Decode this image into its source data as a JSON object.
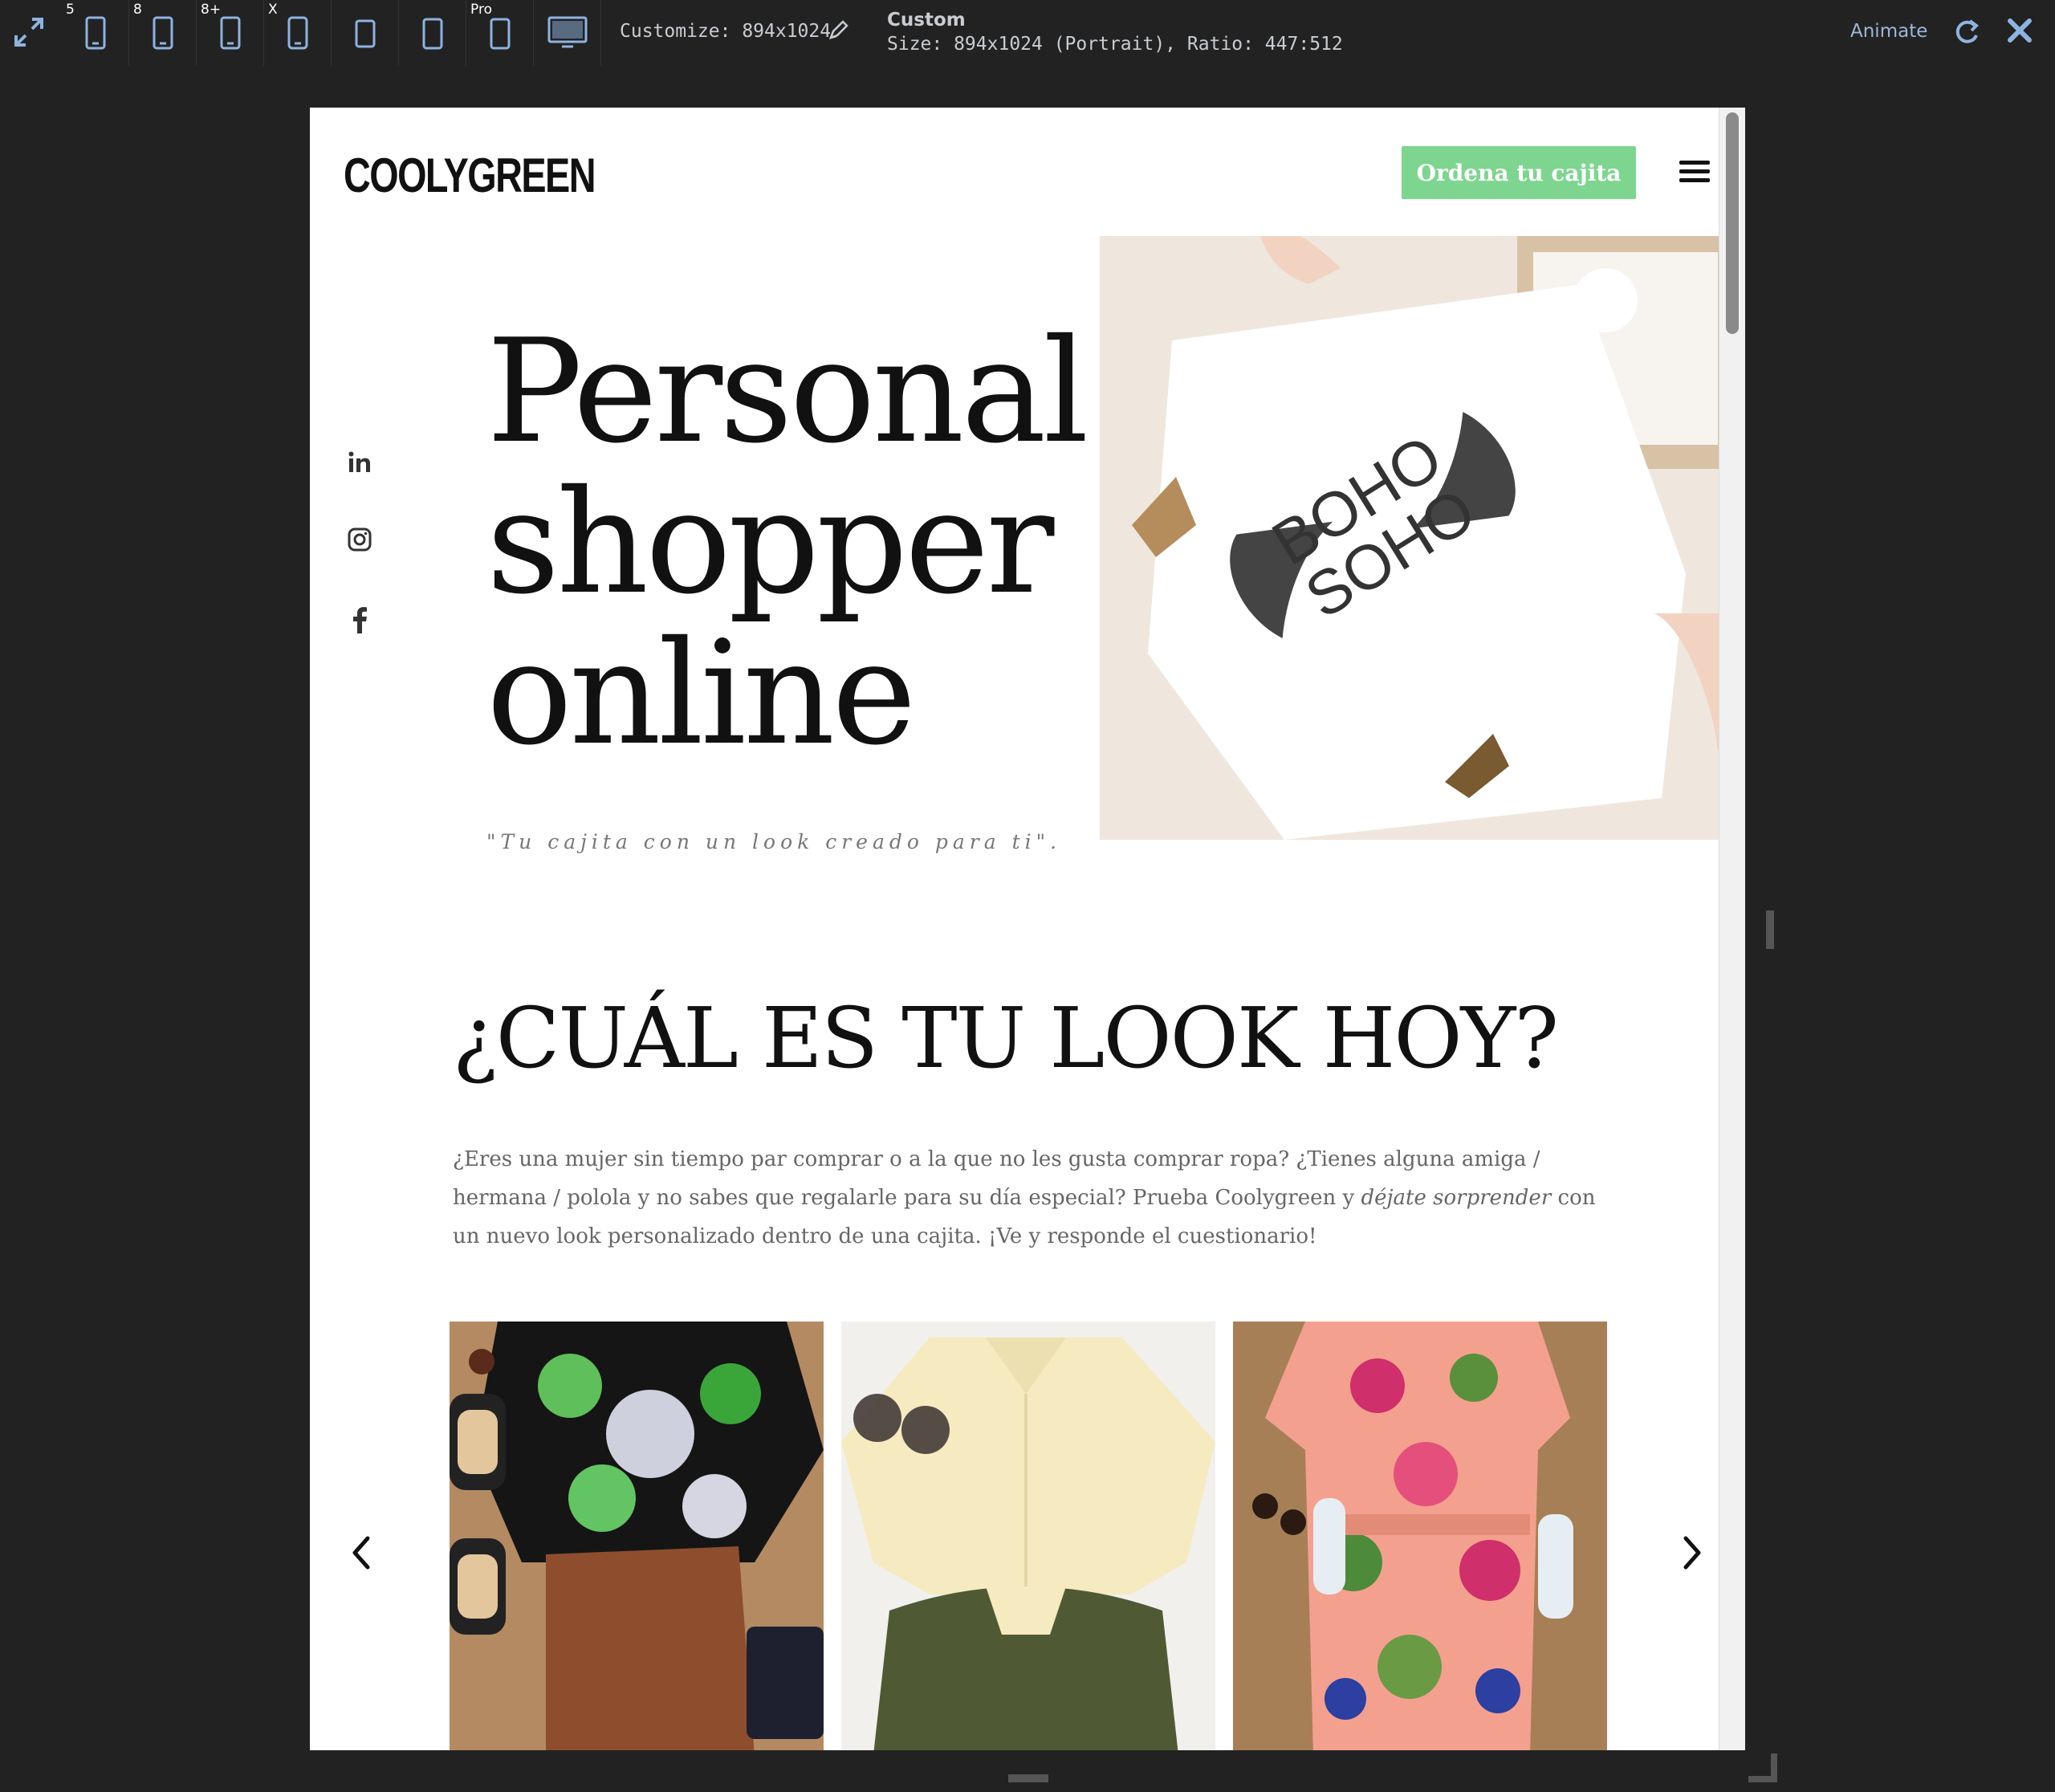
{
  "toolbar": {
    "devices": [
      {
        "label": "5"
      },
      {
        "label": "8"
      },
      {
        "label": "8+"
      },
      {
        "label": "X"
      },
      {
        "label": ""
      },
      {
        "label": ""
      },
      {
        "label": "Pro"
      }
    ],
    "customize_label": "Customize: 894x1024",
    "title": "Custom",
    "size_label": "Size: 894x1024 (Portrait), Ratio: 447:512",
    "animate_label": "Animate"
  },
  "page": {
    "logo": "COOLYGREEN",
    "cta_label": "Ordena tu cajita",
    "social": [
      "linkedin-icon",
      "instagram-icon",
      "facebook-icon"
    ],
    "hero": {
      "title_lines": [
        "Personal",
        "shopper",
        "online"
      ],
      "quote": "\"Tu cajita con un look creado para ti\"."
    },
    "hero_image": {
      "brand_top": "BOHO",
      "brand_bottom": "SOHO"
    },
    "section": {
      "title": "¿CUÁL ES TU LOOK HOY?",
      "text_before": "¿Eres una mujer sin tiempo par comprar o a la que no les gusta comprar ropa? ¿Tienes alguna amiga / hermana / polola y no sabes que regalarle para su día especial? Prueba Coolygreen y ",
      "text_em": "déjate sorprender",
      "text_after": " con un nuevo look personalizado dentro de una cajita. ¡Ve y responde el cuestionario!"
    }
  },
  "colors": {
    "accent": "#7ed58f",
    "toolbar_bg": "#222222",
    "link_blue": "#9fb6d9"
  }
}
